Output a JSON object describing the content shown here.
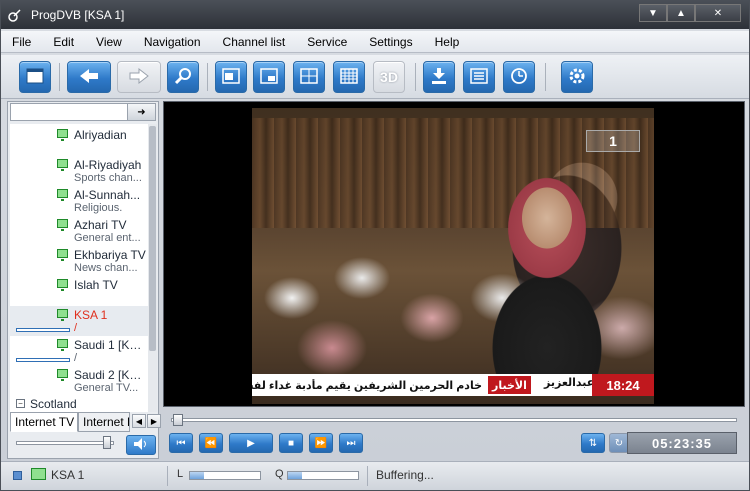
{
  "window": {
    "title": "ProgDVB [KSA 1]"
  },
  "menu": [
    "File",
    "Edit",
    "View",
    "Navigation",
    "Channel list",
    "Service",
    "Settings",
    "Help"
  ],
  "toolbar": {
    "three_d_label": "3D"
  },
  "channels": [
    {
      "name": "Alriyadian",
      "sub": ""
    },
    {
      "name": "Al-Riyadiyah",
      "sub": "Sports chan..."
    },
    {
      "name": "Al-Sunnah...",
      "sub": "Religious."
    },
    {
      "name": "Azhari TV",
      "sub": "General ent..."
    },
    {
      "name": "Ekhbariya TV",
      "sub": "News chan..."
    },
    {
      "name": "Islah TV",
      "sub": ""
    },
    {
      "name": "KSA 1",
      "sub": "/"
    },
    {
      "name": "Saudi 1 [KS...",
      "sub": "/"
    },
    {
      "name": "Saudi 2 [KS...",
      "sub": "General TV..."
    }
  ],
  "group": {
    "name": "Scotland"
  },
  "tabs": [
    {
      "label": "Internet TV"
    },
    {
      "label": "Internet R"
    }
  ],
  "video": {
    "logo": "1",
    "ticker_text": "خادم الحرمين الشريفين يقيم مأدبة غداء لفخامة الرئيس",
    "ticker_tag": "الأخبار",
    "ticker_name": "عبدالعزيز",
    "ticker_time": "18:24"
  },
  "player": {
    "time": "05:23:35",
    "seek_position": 0.0,
    "volume": 0.93
  },
  "status": {
    "channel": "KSA 1",
    "level_label": "L",
    "quality_label": "Q",
    "level": 0.2,
    "quality": 0.2,
    "state": "Buffering..."
  }
}
